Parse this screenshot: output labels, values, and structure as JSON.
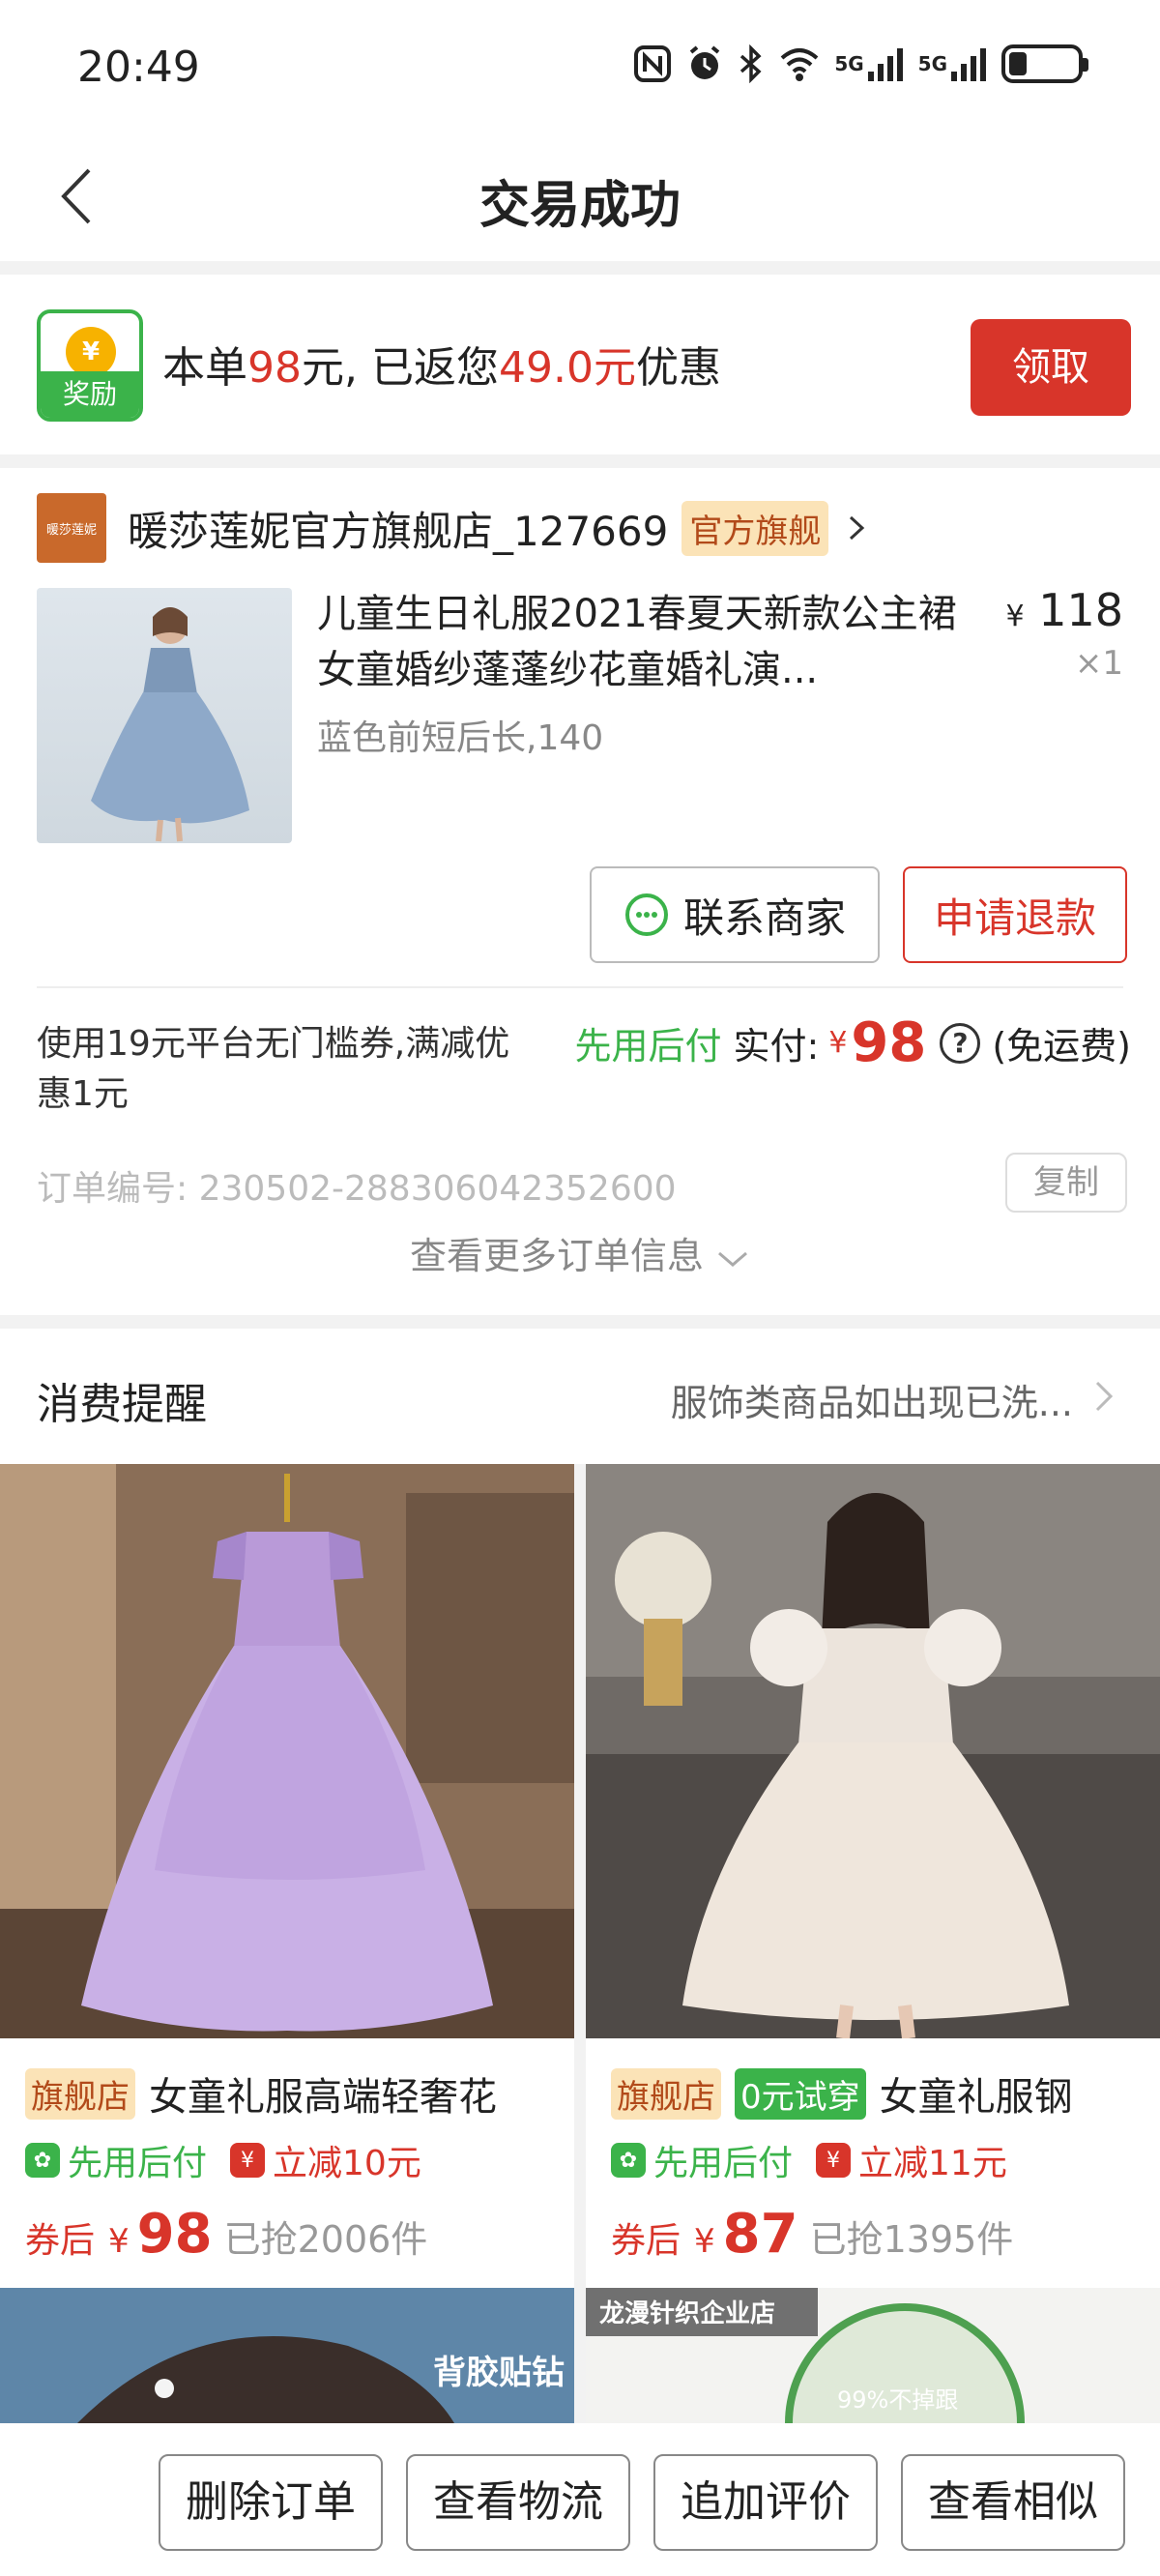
{
  "status": {
    "time": "20:49",
    "net1": "5G",
    "net2": "5G"
  },
  "nav": {
    "title": "交易成功"
  },
  "reward": {
    "badge_label": "奖励",
    "text_prefix": "本单",
    "amount": "98",
    "text_middle": "元, 已返您",
    "rebate": "49.0元",
    "text_suffix": "优惠",
    "claim_label": "领取"
  },
  "order": {
    "shop_logo_text": "暖莎莲妮",
    "shop_name": "暖莎莲妮官方旗舰店_127669",
    "shop_tag": "官方旗舰",
    "product_title": "儿童生日礼服2021春夏天新款公主裙女童婚纱蓬蓬纱花童婚礼演...",
    "product_spec": "蓝色前短后长,140",
    "price_symbol": "¥",
    "price": "118",
    "quantity": "×1",
    "contact_label": "联系商家",
    "refund_label": "申请退款",
    "coupon_text": "使用19元平台无门槛券,满减优惠1元",
    "pay_later": "先用后付",
    "pay_label": "实付:",
    "pay_symbol": "¥",
    "pay_amount": "98",
    "help": "?",
    "free_shipping": "(免运费)",
    "order_number": "订单编号:  230502-288306042352600",
    "copy_label": "复制",
    "more_info": "查看更多订单信息"
  },
  "reminder": {
    "title": "消费提醒",
    "text": "服饰类商品如出现已洗..."
  },
  "recommendations": [
    {
      "tag": "旗舰店",
      "trial_tag": "",
      "title": "女童礼服高端轻奢花",
      "pay_later": "先用后付",
      "discount": "立减10元",
      "after_coupon": "券后",
      "symbol": "¥",
      "price": "98",
      "sold": "已抢2006件"
    },
    {
      "tag": "旗舰店",
      "trial_tag": "0元试穿",
      "title": "女童礼服钢",
      "pay_later": "先用后付",
      "discount": "立减11元",
      "after_coupon": "券后",
      "symbol": "¥",
      "price": "87",
      "sold": "已抢1395件"
    }
  ],
  "peek": {
    "left_text": "背胶贴钻",
    "right_badge": "龙漫针织企业店",
    "right_circle": "99%不掉跟"
  },
  "bottom_bar": {
    "delete": "删除订单",
    "logistics": "查看物流",
    "review": "追加评价",
    "similar": "查看相似"
  },
  "colors": {
    "accent_red": "#d8352a",
    "green": "#3bb34a",
    "tag_bg": "#fbe3b7"
  }
}
